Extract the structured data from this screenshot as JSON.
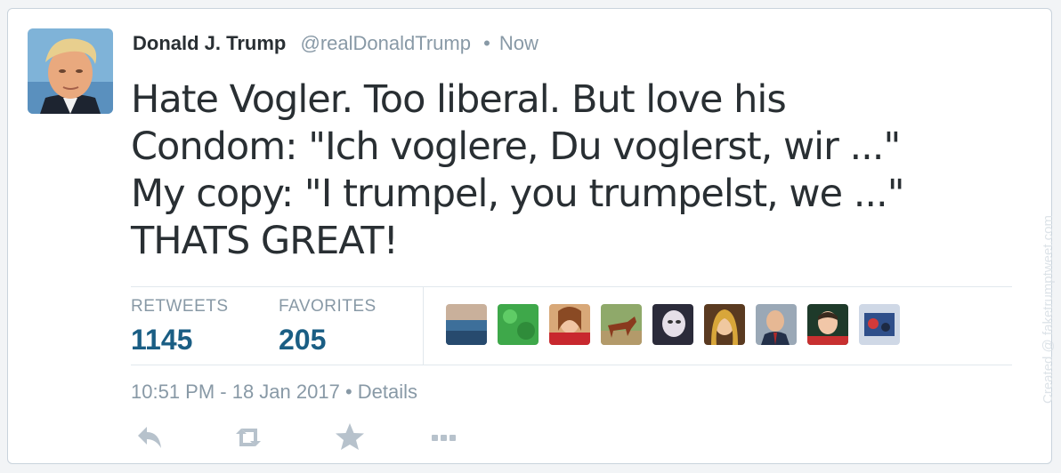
{
  "tweet": {
    "display_name": "Donald J. Trump",
    "handle": "@realDonaldTrump",
    "separator": "•",
    "time": "Now",
    "text_lines": [
      "Hate Vogler. Too liberal. But love his",
      "Condom: \"Ich voglere, Du voglerst, wir ...\"",
      "My copy: \"I trumpel, you trumpelst, we ...\"",
      "THATS GREAT!"
    ]
  },
  "stats": {
    "retweets_label": "RETWEETS",
    "retweets_value": "1145",
    "favorites_label": "FAVORITES",
    "favorites_value": "205"
  },
  "meta": {
    "timestamp": "10:51 PM - 18 Jan 2017",
    "separator": "•",
    "details_label": "Details"
  },
  "actions": [
    "reply-icon",
    "retweet-icon",
    "favorite-icon",
    "more-icon"
  ],
  "watermark": "Created @ faketrumptweet.com",
  "colors": {
    "stat_value": "#1a5e84",
    "muted": "#8899a6",
    "text": "#292f33"
  }
}
